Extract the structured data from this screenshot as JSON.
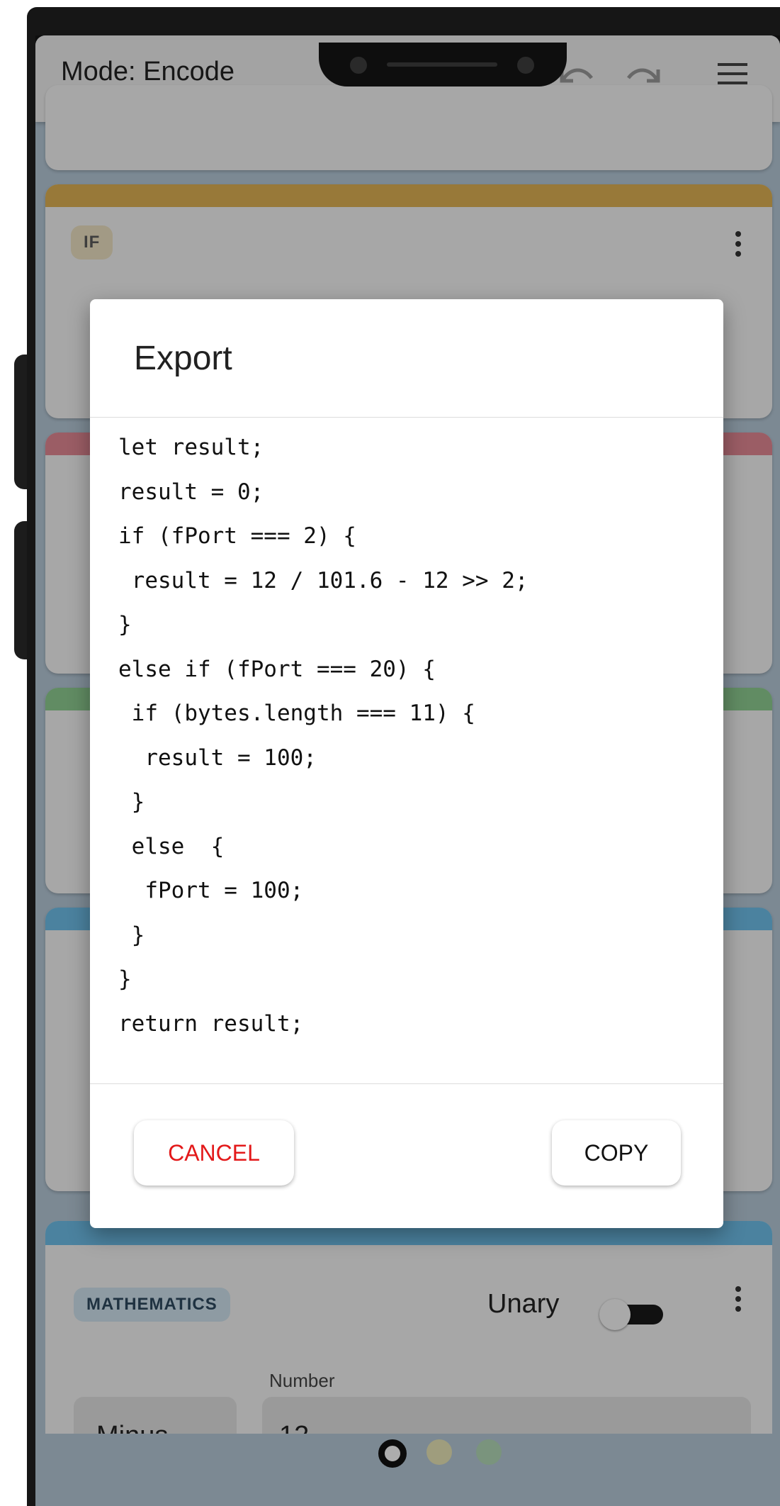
{
  "app": {
    "mode_label": "Mode: Encode",
    "icons": {
      "undo": "undo-icon",
      "redo": "redo-icon",
      "menu": "hamburger-menu-icon"
    }
  },
  "blocks": {
    "if_block": {
      "tag": "IF",
      "color": "#e0b355"
    },
    "math_block": {
      "tag": "MATHEMATICS",
      "unary_label": "Unary",
      "unary_on": false,
      "operator": "Minus",
      "number_label": "Number",
      "number_value": "12",
      "color": "#6fc0ea"
    }
  },
  "page_indicator": {
    "active_index": 0,
    "count": 3,
    "colors": [
      "#111111",
      "#eae8b8",
      "#b4dab8"
    ]
  },
  "dialog": {
    "title": "Export",
    "code": "let result;\nresult = 0;\nif (fPort === 2) {\n result = 12 / 101.6 - 12 >> 2;\n}\nelse if (fPort === 20) {\n if (bytes.length === 11) {\n  result = 100;\n }\n else  {\n  fPort = 100;\n }\n}\nreturn result;",
    "cancel_label": "CANCEL",
    "copy_label": "COPY"
  }
}
